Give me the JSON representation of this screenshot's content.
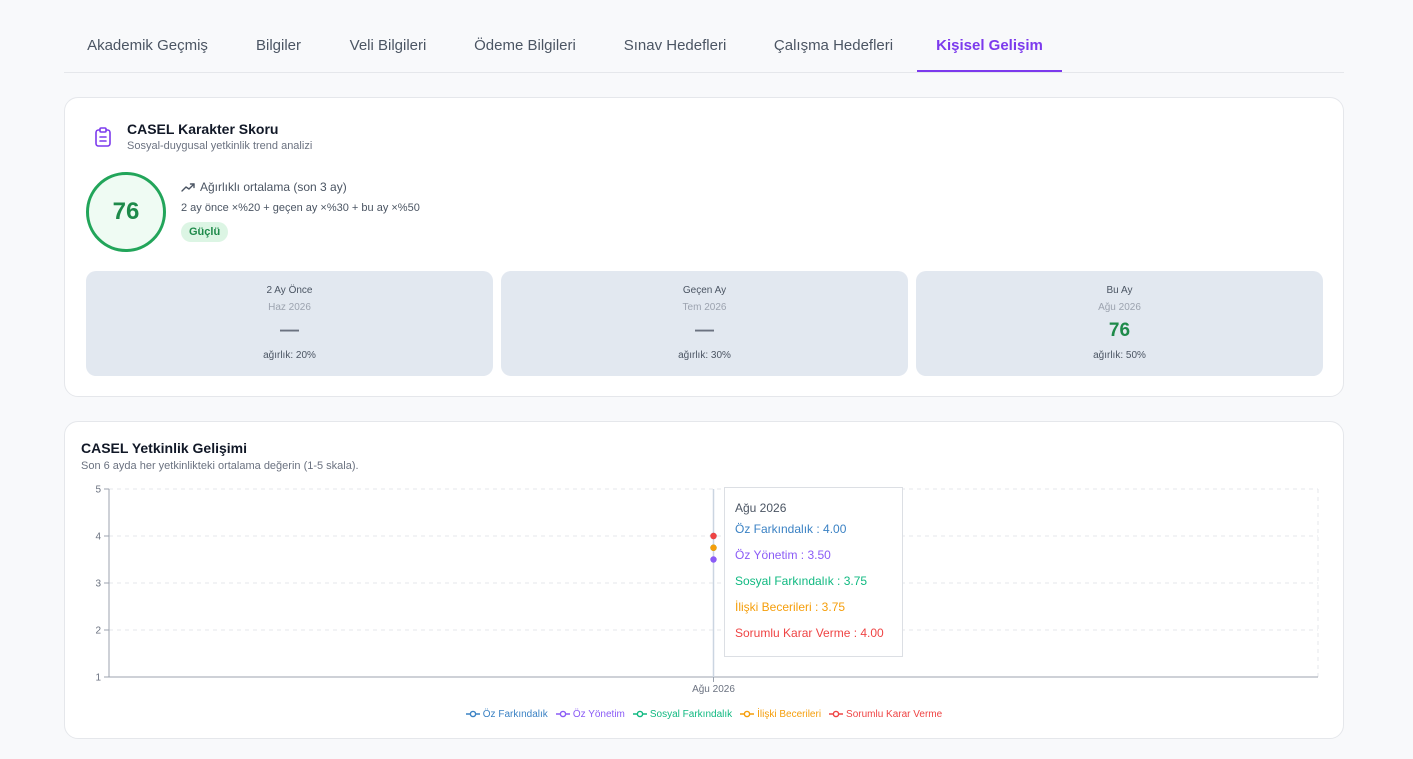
{
  "tabs": [
    {
      "label": "Akademik Geçmiş",
      "active": false
    },
    {
      "label": "Bilgiler",
      "active": false
    },
    {
      "label": "Veli Bilgileri",
      "active": false
    },
    {
      "label": "Ödeme Bilgileri",
      "active": false
    },
    {
      "label": "Sınav Hedefleri",
      "active": false
    },
    {
      "label": "Çalışma Hedefleri",
      "active": false
    },
    {
      "label": "Kişisel Gelişim",
      "active": true
    }
  ],
  "score_card": {
    "icon": "clipboard-icon",
    "title": "CASEL Karakter Skoru",
    "subtitle": "Sosyal-duygusal yetkinlik trend analizi",
    "score": "76",
    "average_label": "Ağırlıklı ortalama (son 3 ay)",
    "formula": "2 ay önce ×%20 + geçen ay ×%30 + bu ay ×%50",
    "badge": "Güçlü",
    "months": [
      {
        "label": "2 Ay Önce",
        "date": "Haz 2026",
        "value": "—",
        "weight": "ağırlık: 20%"
      },
      {
        "label": "Geçen Ay",
        "date": "Tem 2026",
        "value": "—",
        "weight": "ağırlık: 30%"
      },
      {
        "label": "Bu Ay",
        "date": "Ağu 2026",
        "value": "76",
        "weight": "ağırlık: 50%"
      }
    ]
  },
  "chart_card": {
    "title": "CASEL Yetkinlik Gelişimi",
    "subtitle": "Son 6 ayda her yetkinlikteki ortalama değerin (1-5 skala)."
  },
  "chart_data": {
    "type": "line",
    "x": [
      "Ağu 2026"
    ],
    "ylim": [
      1,
      5
    ],
    "yticks": [
      "1",
      "2",
      "3",
      "4",
      "5"
    ],
    "grid": true,
    "legend": "bottom",
    "series": [
      {
        "name": "Öz Farkındalık",
        "values": [
          4.0
        ],
        "color": "#3b82c4"
      },
      {
        "name": "Öz Yönetim",
        "values": [
          3.5
        ],
        "color": "#8b5cf6"
      },
      {
        "name": "Sosyal Farkındalık",
        "values": [
          3.75
        ],
        "color": "#10b981"
      },
      {
        "name": "İlişki Becerileri",
        "values": [
          3.75
        ],
        "color": "#f59e0b"
      },
      {
        "name": "Sorumlu Karar Verme",
        "values": [
          4.0
        ],
        "color": "#ef4444"
      }
    ],
    "tooltip": {
      "title": "Ağu 2026",
      "rows": [
        "Öz Farkındalık : 4.00",
        "Öz Yönetim : 3.50",
        "Sosyal Farkındalık : 3.75",
        "İlişki Becerileri : 3.75",
        "Sorumlu Karar Verme : 4.00"
      ]
    }
  },
  "colors": {
    "accent": "#7c3aed",
    "success": "#22a55a",
    "box_bg": "#e2e8f0"
  }
}
